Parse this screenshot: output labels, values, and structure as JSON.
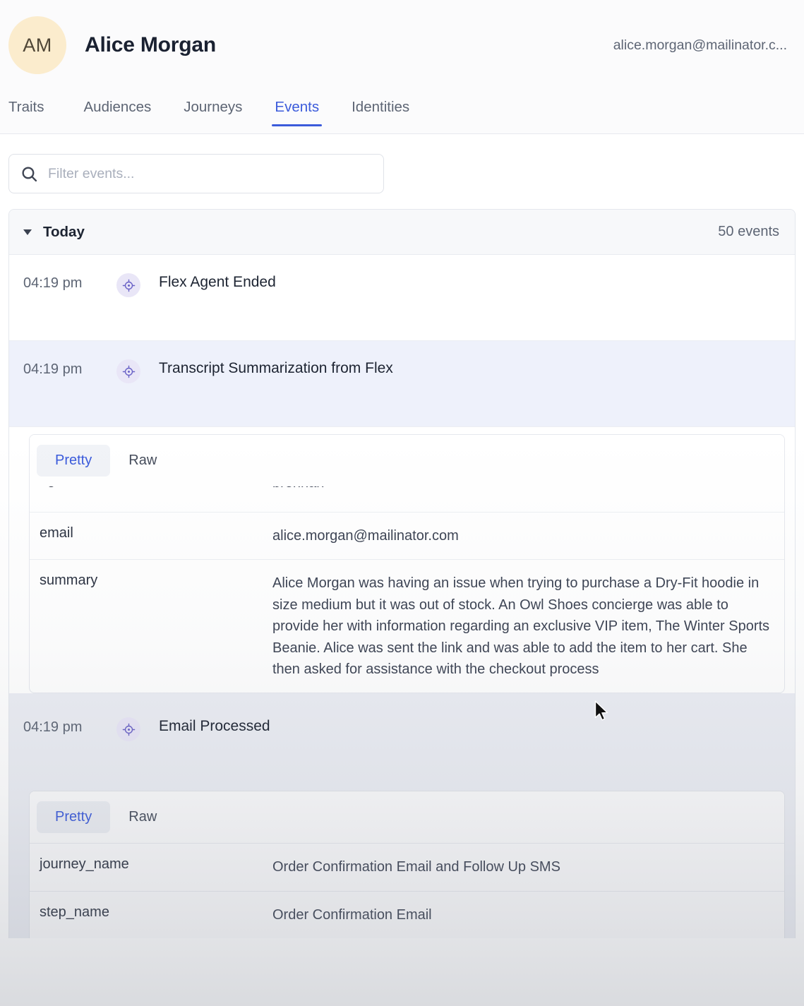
{
  "profile": {
    "initials": "AM",
    "name": "Alice Morgan",
    "email": "alice.morgan@mailinator.c..."
  },
  "tabs": [
    {
      "label": "Traits",
      "active": false
    },
    {
      "label": "Audiences",
      "active": false
    },
    {
      "label": "Journeys",
      "active": false
    },
    {
      "label": "Events",
      "active": true
    },
    {
      "label": "Identities",
      "active": false
    }
  ],
  "search": {
    "placeholder": "Filter events...",
    "value": "",
    "icon": "search-icon"
  },
  "group": {
    "caret": "caret-down-icon",
    "title": "Today",
    "count": "50 events"
  },
  "detail_tabs": {
    "pretty": "Pretty",
    "raw": "Raw"
  },
  "events": [
    {
      "time": "04:19 pm",
      "icon": "target-crosshair-icon",
      "name": "Flex Agent Ended",
      "selected": false,
      "expanded": false
    },
    {
      "time": "04:19 pm",
      "icon": "target-crosshair-icon",
      "name": "Transcript Summarization from Flex",
      "selected": true,
      "expanded": true,
      "properties": [
        {
          "key": "agent",
          "value": "brennan"
        },
        {
          "key": "email",
          "value": "alice.morgan@mailinator.com"
        },
        {
          "key": "summary",
          "value": "Alice Morgan was having an issue when trying to purchase a Dry-Fit hoodie in size medium but it was out of stock. An Owl Shoes concierge was able to provide her with information regarding an exclusive VIP item, The Winter Sports Beanie. Alice was sent the link and was able to add the item to her cart. She then asked for assistance with the checkout process"
        }
      ]
    },
    {
      "time": "04:19 pm",
      "icon": "target-crosshair-icon",
      "name": "Email Processed",
      "selected": false,
      "expanded": true,
      "properties": [
        {
          "key": "journey_name",
          "value": "Order Confirmation Email and Follow Up SMS"
        },
        {
          "key": "step_name",
          "value": "Order Confirmation Email"
        }
      ]
    }
  ],
  "colors": {
    "accent": "#3b5bdb",
    "avatar_bg": "#fbeccd",
    "badge_bg": "#e9e6f7",
    "badge_icon": "#6b63c7",
    "selected_row_bg": "#eef1fb",
    "text_primary": "#1d2432",
    "text_muted": "#5d6574"
  }
}
